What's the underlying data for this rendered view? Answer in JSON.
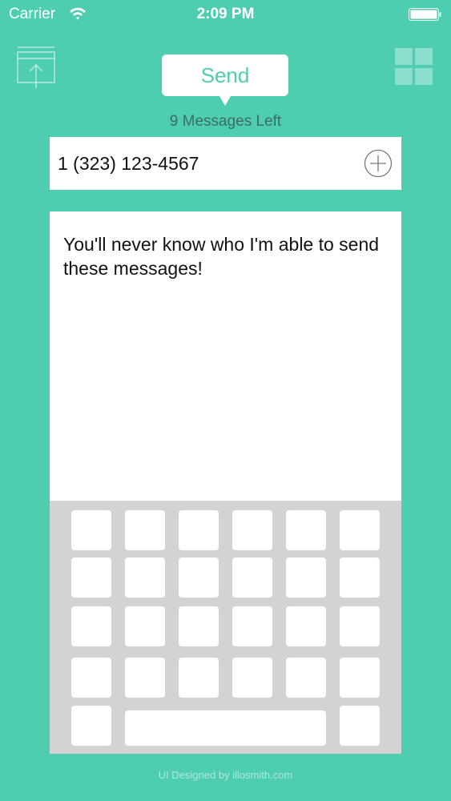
{
  "colors": {
    "accent": "#4ecdb0",
    "white": "#ffffff",
    "keyboard": "#d3d3d3"
  },
  "status_bar": {
    "carrier": "Carrier",
    "time": "2:09 PM",
    "wifi_icon": "wifi-icon",
    "battery_icon": "battery-icon"
  },
  "header": {
    "share_icon": "share-icon",
    "send_label": "Send",
    "grid_icon": "grid-icon",
    "messages_left": "9 Messages Left"
  },
  "recipient": {
    "phone": "1 (323) 123-4567",
    "add_icon": "plus-circle-icon"
  },
  "message": {
    "text": "You'll never know who I'm able to send these messages!"
  },
  "footer": {
    "credit": "UI Designed by illosmith.com"
  }
}
